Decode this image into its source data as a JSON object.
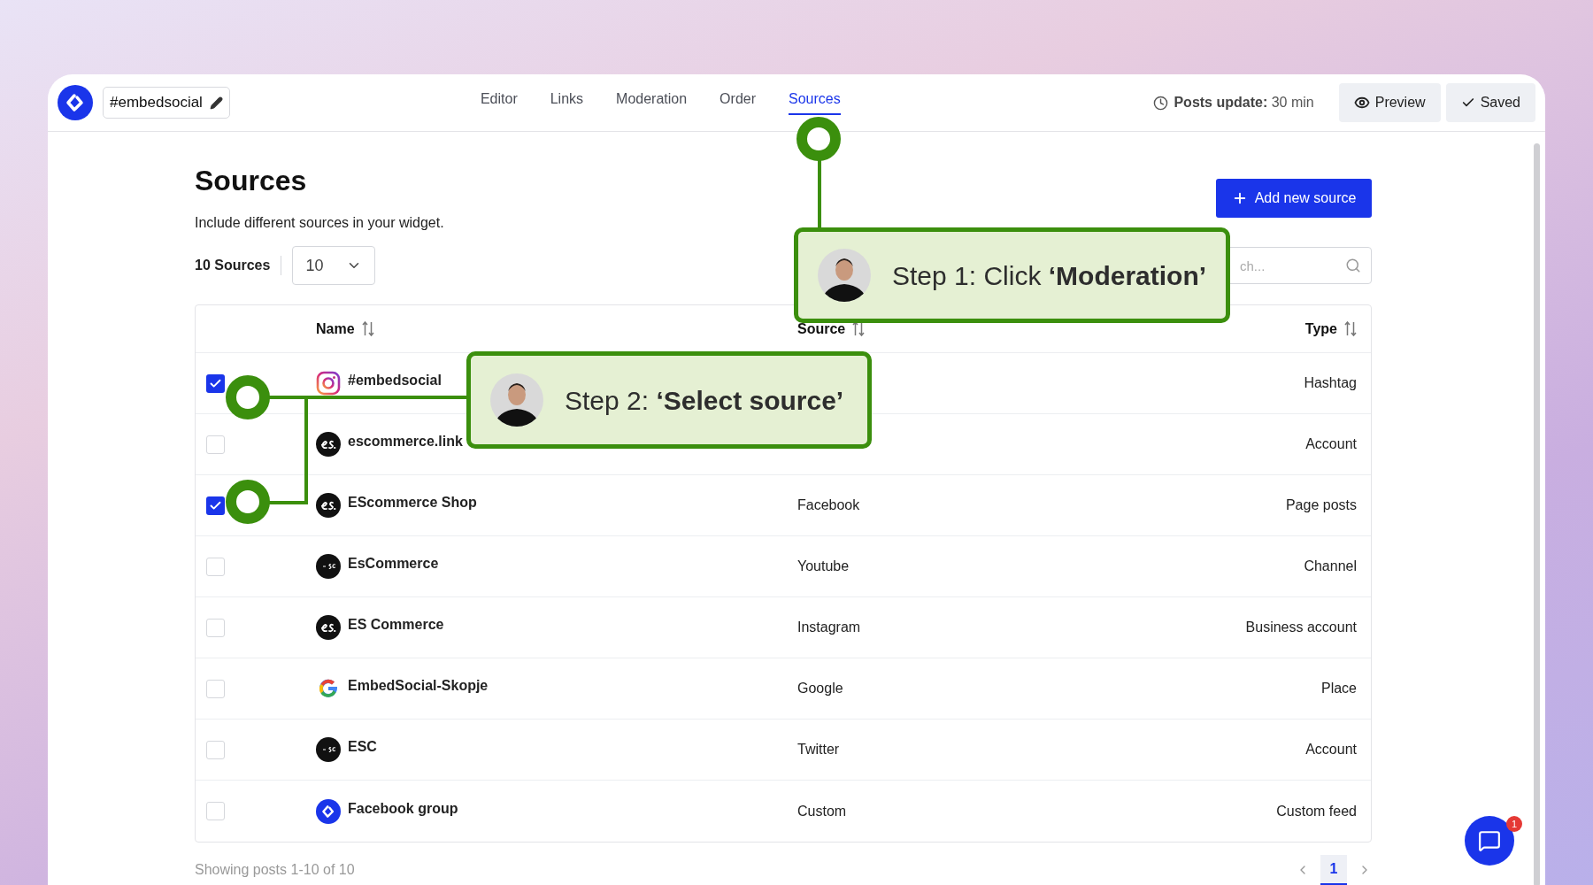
{
  "header": {
    "widget_name": "#embedsocial",
    "tabs": [
      {
        "label": "Editor",
        "selected": false
      },
      {
        "label": "Links",
        "selected": false
      },
      {
        "label": "Moderation",
        "selected": false
      },
      {
        "label": "Order",
        "selected": false
      },
      {
        "label": "Sources",
        "selected": true
      }
    ],
    "posts_update": {
      "label": "Posts update:",
      "value": "30 min"
    },
    "buttons": [
      {
        "kind": "preview",
        "label": "Preview"
      },
      {
        "kind": "saved",
        "label": "Saved"
      }
    ]
  },
  "page": {
    "title": "Sources",
    "subtitle": "Include different sources in your widget.",
    "count": "10 Sources",
    "page_size": "10",
    "add_button": "Add new source",
    "search": {
      "placeholder": "ch..."
    }
  },
  "table": {
    "columns": [
      "Name",
      "Source",
      "Type"
    ],
    "rows": [
      {
        "checked": true,
        "kind": "instagram",
        "name": "#embedsocial",
        "type": "Hashtag"
      },
      {
        "checked": false,
        "kind": "es",
        "name": "escommerce.link",
        "type": "Account"
      },
      {
        "checked": true,
        "kind": "es",
        "name": "EScommerce Shop",
        "source": "Facebook",
        "type": "Page posts"
      },
      {
        "checked": false,
        "kind": "esc",
        "name": "EsCommerce",
        "source": "Youtube",
        "type": "Channel"
      },
      {
        "checked": false,
        "kind": "es",
        "name": "ES Commerce",
        "source": "Instagram",
        "type": "Business account"
      },
      {
        "checked": false,
        "kind": "google",
        "name": "EmbedSocial-Skopje",
        "source": "Google",
        "type": "Place"
      },
      {
        "checked": false,
        "kind": "esc",
        "name": "ESC",
        "source": "Twitter",
        "type": "Account"
      },
      {
        "checked": false,
        "kind": "embedsocial",
        "name": "Facebook group",
        "source": "Custom",
        "type": "Custom feed"
      }
    ]
  },
  "footer": {
    "showing": "Showing posts 1-10 of 10",
    "pages": [
      {
        "label": "1",
        "selected": true
      }
    ]
  },
  "chat": {
    "badge": "1"
  },
  "callouts": [
    {
      "step": "Step 1: Click",
      "action": "‘Moderation’"
    },
    {
      "step": "Step 2:",
      "action": "‘Select source’"
    }
  ]
}
